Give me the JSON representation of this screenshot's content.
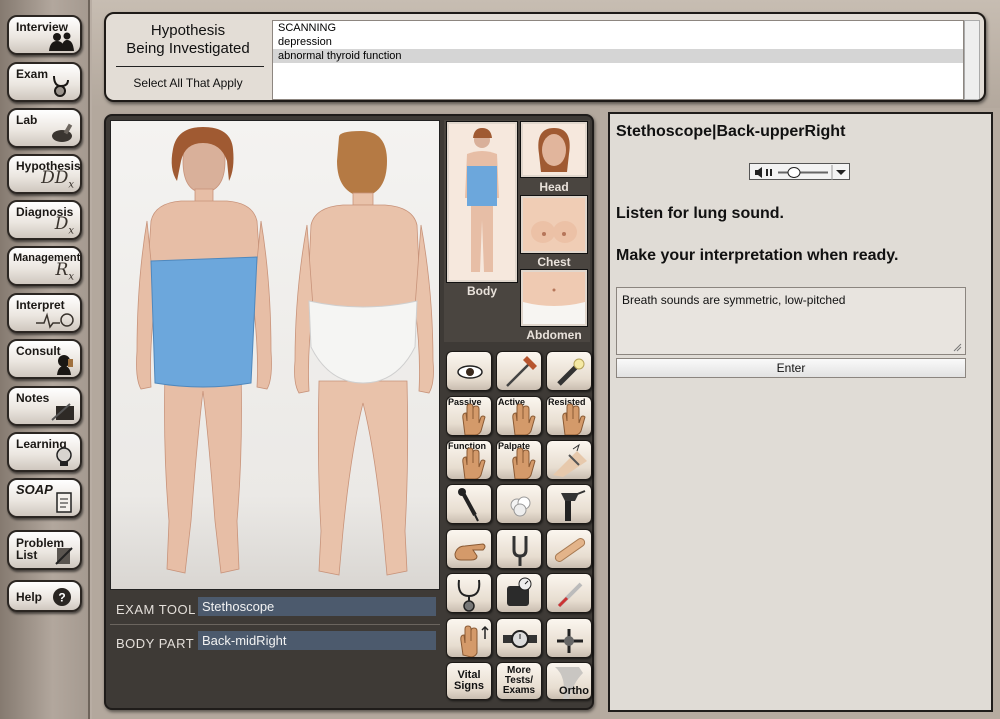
{
  "nav": {
    "items": [
      {
        "label": "Interview"
      },
      {
        "label": "Exam"
      },
      {
        "label": "Lab"
      },
      {
        "label": "Hypothesis",
        "symbol": "DD",
        "sub": "x"
      },
      {
        "label": "Diagnosis",
        "symbol": "D",
        "sub": "x"
      },
      {
        "label": "Management",
        "symbol": "R",
        "sub": "x"
      },
      {
        "label": "Interpret"
      },
      {
        "label": "Consult"
      },
      {
        "label": "Notes"
      },
      {
        "label": "Learning"
      },
      {
        "label": "SOAP"
      },
      {
        "label": "Problem\nList"
      },
      {
        "label": "Help",
        "symbol": "?"
      }
    ]
  },
  "hypothesis": {
    "title": "Hypothesis\nBeing Investigated",
    "select_label": "Select All That Apply",
    "options": [
      {
        "text": "SCANNING",
        "selected": false
      },
      {
        "text": "depression",
        "selected": false
      },
      {
        "text": "abnormal thyroid function",
        "selected": true
      }
    ]
  },
  "exam": {
    "tool_label": "EXAM TOOL",
    "tool_value": "Stethoscope",
    "part_label": "BODY PART",
    "part_value": "Back-midRight"
  },
  "thumbnails": {
    "body": "Body",
    "head": "Head",
    "chest": "Chest",
    "abdomen": "Abdomen"
  },
  "tools": {
    "passive": "Passive",
    "active": "Active",
    "resisted": "Resisted",
    "function": "Function",
    "palpate": "Palpate",
    "vital_signs": "Vital\nSigns",
    "more_tests": "More\nTests/\nExams",
    "ortho": "Ortho"
  },
  "result": {
    "title": "Stethoscope|Back-upperRight",
    "instruction": "Listen for lung sound.",
    "prompt": "Make your interpretation when ready.",
    "interpretation": "Breath sounds are symmetric, low-pitched",
    "enter_label": "Enter"
  },
  "colors": {
    "field_value_bg": "#4c5a6d",
    "panel_dark": "#3e3a36",
    "selection": "#d5d5d5"
  }
}
